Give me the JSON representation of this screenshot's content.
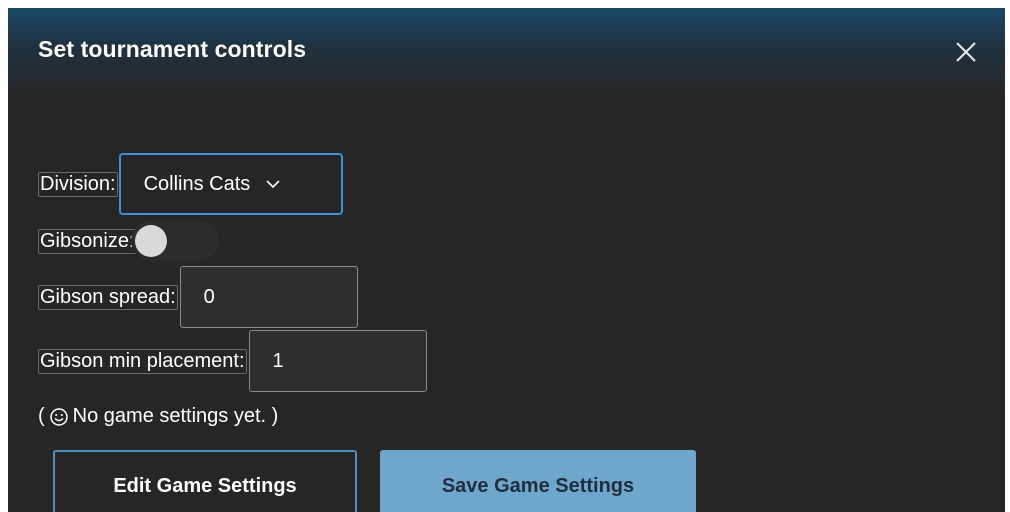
{
  "modal": {
    "title": "Set tournament controls",
    "close_label": "X"
  },
  "division": {
    "label": "Division:",
    "selected": "Collins Cats"
  },
  "gibsonize": {
    "label": "Gibsonize:",
    "enabled": false
  },
  "gibson_spread": {
    "label": "Gibson spread:",
    "value": "0"
  },
  "gibson_min_placement": {
    "label": "Gibson min placement:",
    "value": "1"
  },
  "note": {
    "open_paren": "(",
    "text": "No game settings yet. )",
    "icon": "smile-icon"
  },
  "buttons": {
    "edit_label": "Edit Game Settings",
    "save_label": "Save Game Settings"
  },
  "colors": {
    "modal_bg": "#262626",
    "header_accent": "#1a4868",
    "focus_border": "#3d8fd9",
    "save_button_bg": "#6fa6cc"
  }
}
